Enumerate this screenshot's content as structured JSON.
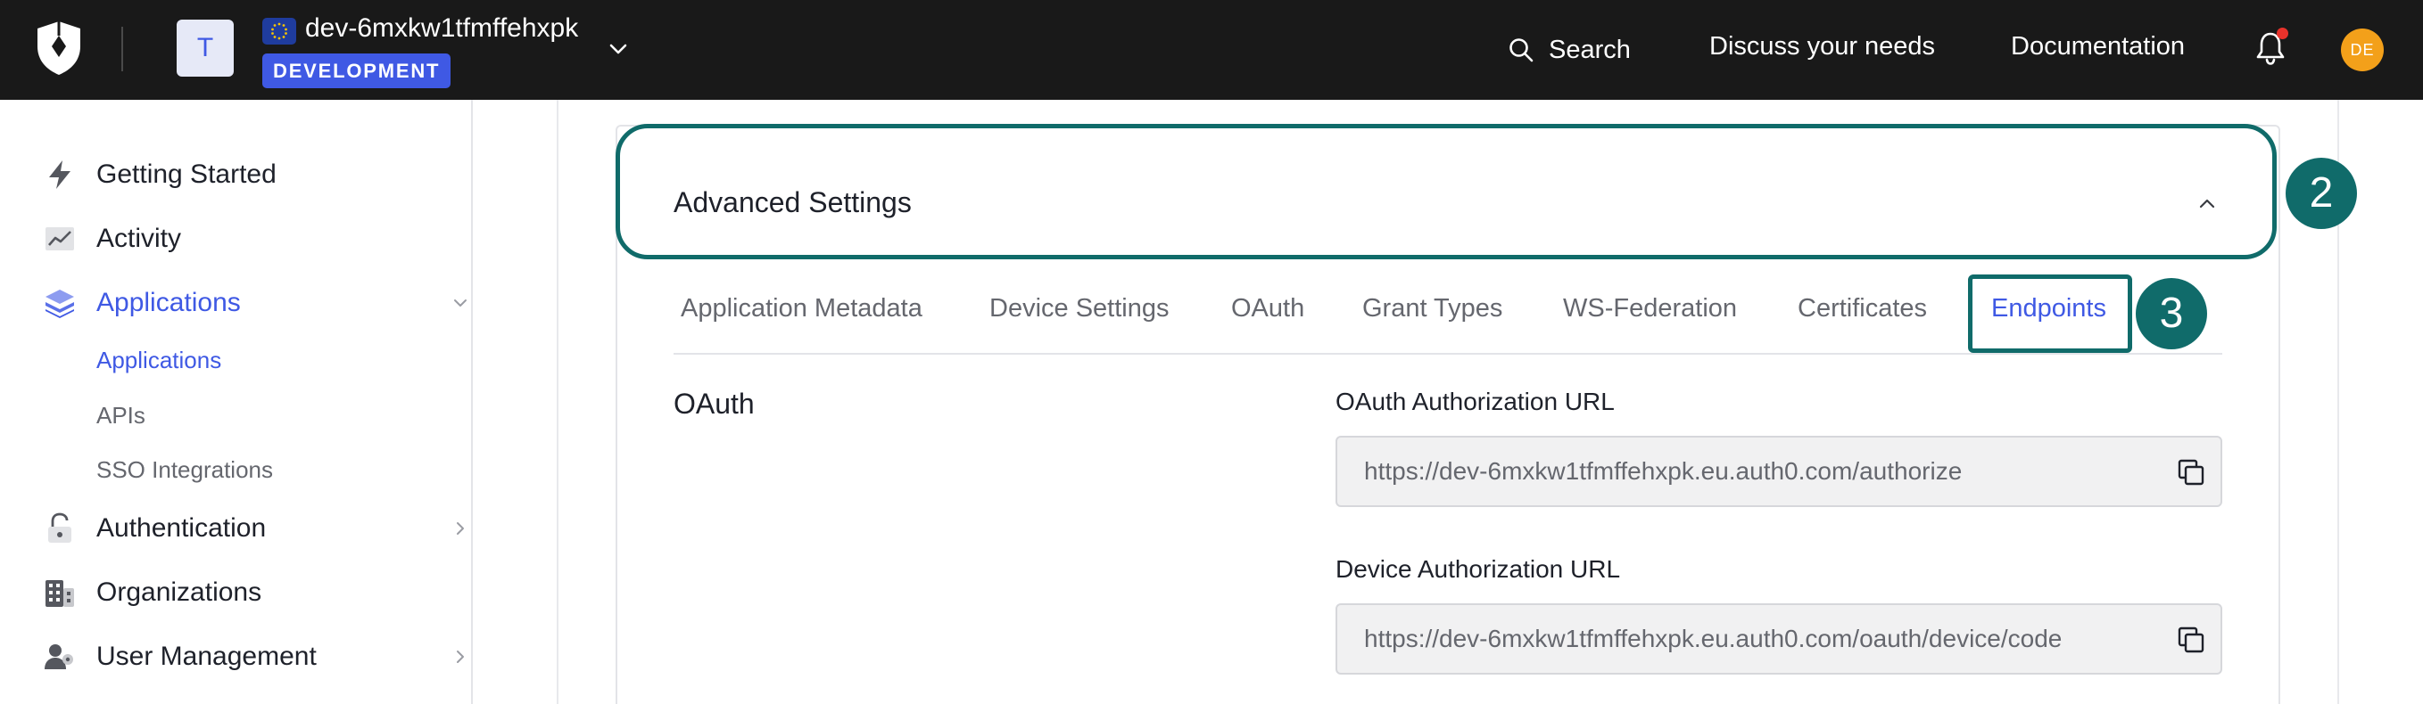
{
  "header": {
    "tenant_avatar_letter": "T",
    "tenant_name": "dev-6mxkw1tfmffehxpk",
    "environment": "DEVELOPMENT",
    "search_label": "Search",
    "links": [
      "Discuss your needs",
      "Documentation"
    ],
    "user_initials": "DE"
  },
  "sidebar": {
    "items": [
      {
        "label": "Getting Started",
        "icon": "bolt-icon"
      },
      {
        "label": "Activity",
        "icon": "activity-chart-icon"
      },
      {
        "label": "Applications",
        "icon": "layers-icon",
        "active": true,
        "expanded": true
      },
      {
        "label": "Authentication",
        "icon": "lock-icon"
      },
      {
        "label": "Organizations",
        "icon": "building-icon"
      },
      {
        "label": "User Management",
        "icon": "users-icon"
      }
    ],
    "sub_items": [
      {
        "label": "Applications",
        "active": true
      },
      {
        "label": "APIs"
      },
      {
        "label": "SSO Integrations"
      }
    ]
  },
  "section": {
    "title": "Advanced Settings",
    "step_badges": [
      "2",
      "3"
    ],
    "tabs": [
      "Application Metadata",
      "Device Settings",
      "OAuth",
      "Grant Types",
      "WS-Federation",
      "Certificates",
      "Endpoints"
    ],
    "active_tab": "Endpoints",
    "group_heading": "OAuth",
    "fields": [
      {
        "label": "OAuth Authorization URL",
        "value": "https://dev-6mxkw1tfmffehxpk.eu.auth0.com/authorize"
      },
      {
        "label": "Device Authorization URL",
        "value": "https://dev-6mxkw1tfmffehxpk.eu.auth0.com/oauth/device/code"
      }
    ]
  },
  "colors": {
    "topbar": "#191919",
    "accent": "#3f59e4",
    "annotation": "#106b6a",
    "notification": "#e8322b",
    "user_avatar": "#f3a01a"
  }
}
